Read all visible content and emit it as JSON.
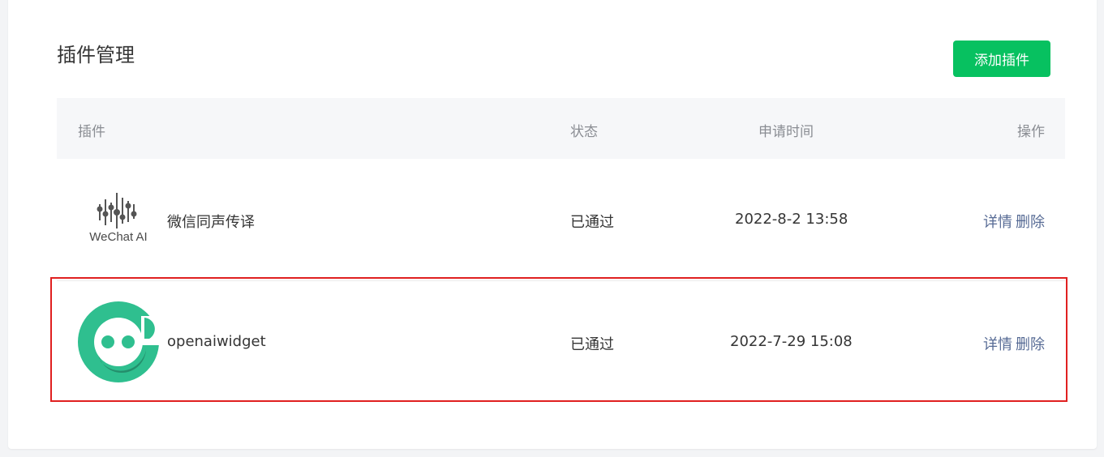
{
  "page": {
    "title": "插件管理",
    "add_button": "添加插件"
  },
  "table": {
    "headers": {
      "plugin": "插件",
      "status": "状态",
      "time": "申请时间",
      "ops": "操作"
    },
    "rows": [
      {
        "logo_icon": "wechat-ai-logo",
        "logo_text": "WeChat AI",
        "name": "微信同声传译",
        "status": "已通过",
        "time": "2022-8-2 13:58",
        "detail": "详情",
        "delete": "删除"
      },
      {
        "logo_icon": "openaiwidget-logo",
        "name": "openaiwidget",
        "status": "已通过",
        "time": "2022-7-29 15:08",
        "detail": "详情",
        "delete": "删除"
      }
    ]
  },
  "colors": {
    "primary_green": "#07c160",
    "link_blue": "#576b95",
    "highlight_red": "#e02020",
    "logo_green": "#2fbf8f"
  }
}
